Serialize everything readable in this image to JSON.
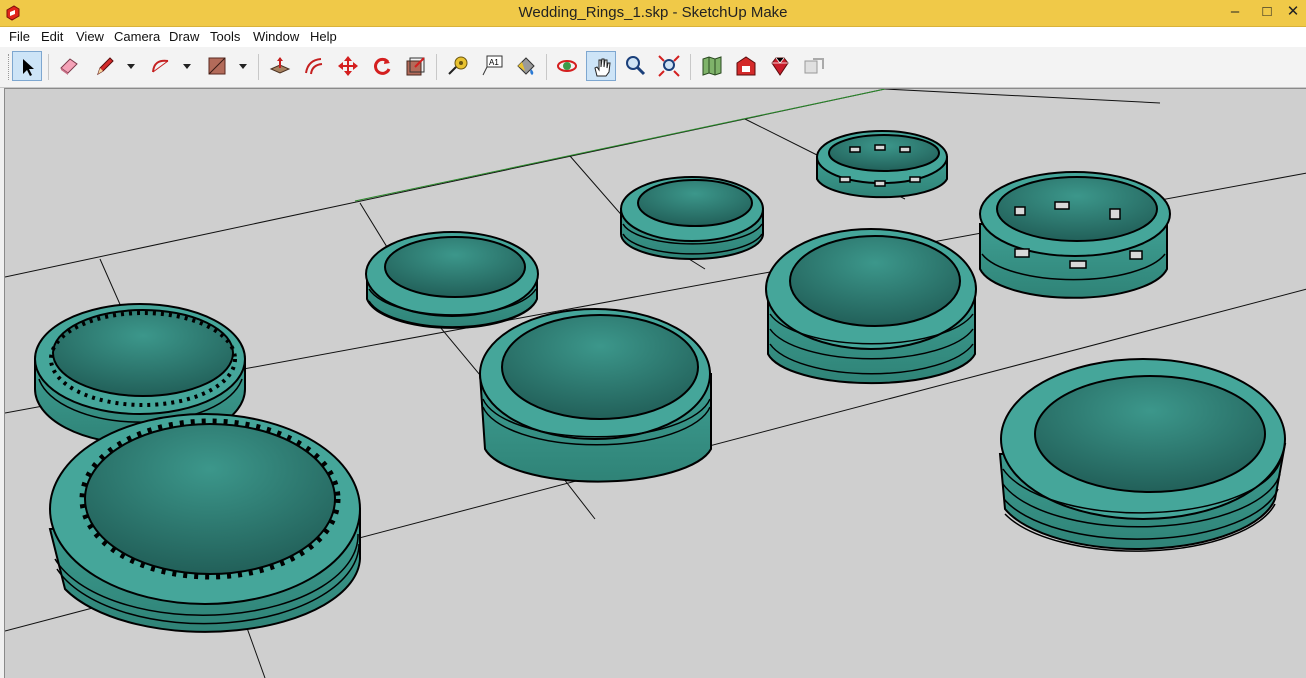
{
  "window": {
    "title": "Wedding_Rings_1.skp - SketchUp Make"
  },
  "menubar": {
    "items": [
      "File",
      "Edit",
      "View",
      "Camera",
      "Draw",
      "Tools",
      "Window",
      "Help"
    ]
  },
  "toolbar": {
    "tools": [
      {
        "name": "select-tool",
        "icon": "arrow-cursor-icon",
        "active": true
      },
      {
        "name": "eraser-tool",
        "icon": "eraser-icon"
      },
      {
        "name": "line-tool",
        "icon": "pencil-icon"
      },
      {
        "name": "arc-tool",
        "icon": "arc-icon"
      },
      {
        "name": "rectangle-tool",
        "icon": "rectangle-icon"
      },
      {
        "name": "push-pull-tool",
        "icon": "push-pull-icon"
      },
      {
        "name": "offset-tool",
        "icon": "offset-icon"
      },
      {
        "name": "move-tool",
        "icon": "move-arrows-icon"
      },
      {
        "name": "rotate-tool",
        "icon": "rotate-icon"
      },
      {
        "name": "scale-tool",
        "icon": "scale-icon"
      },
      {
        "name": "tape-measure-tool",
        "icon": "tape-measure-icon"
      },
      {
        "name": "text-tool",
        "icon": "text-label-icon",
        "label": "A1"
      },
      {
        "name": "paint-bucket-tool",
        "icon": "paint-bucket-icon"
      },
      {
        "name": "orbit-tool",
        "icon": "orbit-icon"
      },
      {
        "name": "pan-tool",
        "icon": "hand-icon",
        "active": true
      },
      {
        "name": "zoom-tool",
        "icon": "magnifier-icon"
      },
      {
        "name": "zoom-extents-tool",
        "icon": "zoom-extents-icon"
      },
      {
        "name": "map-tool",
        "icon": "map-icon"
      },
      {
        "name": "warehouse-tool",
        "icon": "warehouse-icon"
      },
      {
        "name": "extension-tool",
        "icon": "ruby-gem-icon"
      },
      {
        "name": "share-model-tool",
        "icon": "share-icon"
      }
    ]
  },
  "colors": {
    "ring": "#3d9b8f",
    "ring_shadow": "#1f5a55",
    "ground": "#cfcfcf",
    "title_bar": "#f0c948"
  }
}
